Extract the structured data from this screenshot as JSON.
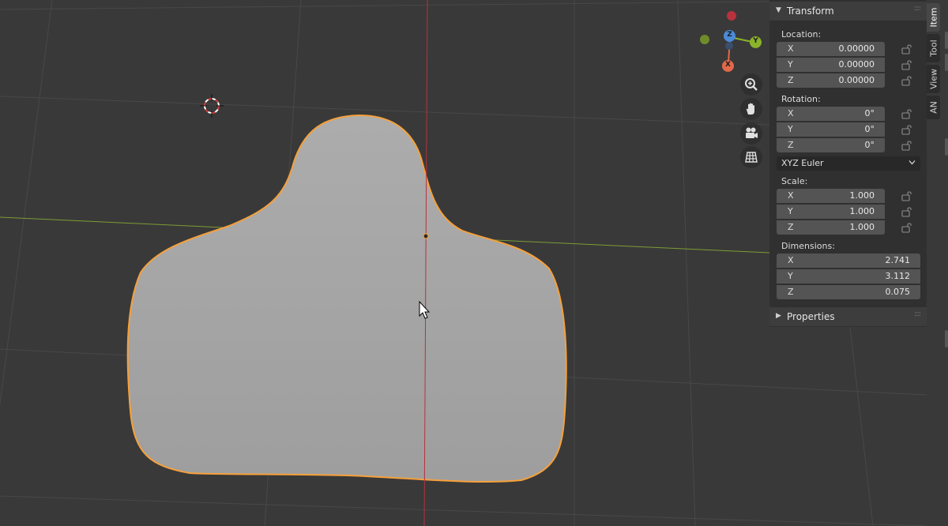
{
  "transform_panel": {
    "title": "Transform",
    "location": {
      "label": "Location:",
      "rows": [
        {
          "axis": "X",
          "value": "0.00000"
        },
        {
          "axis": "Y",
          "value": "0.00000"
        },
        {
          "axis": "Z",
          "value": "0.00000"
        }
      ]
    },
    "rotation": {
      "label": "Rotation:",
      "rows": [
        {
          "axis": "X",
          "value": "0°"
        },
        {
          "axis": "Y",
          "value": "0°"
        },
        {
          "axis": "Z",
          "value": "0°"
        }
      ],
      "mode": "XYZ Euler"
    },
    "scale": {
      "label": "Scale:",
      "rows": [
        {
          "axis": "X",
          "value": "1.000"
        },
        {
          "axis": "Y",
          "value": "1.000"
        },
        {
          "axis": "Z",
          "value": "1.000"
        }
      ]
    },
    "dimensions": {
      "label": "Dimensions:",
      "rows": [
        {
          "axis": "X",
          "value": "2.741"
        },
        {
          "axis": "Y",
          "value": "3.112"
        },
        {
          "axis": "Z",
          "value": "0.075"
        }
      ]
    }
  },
  "properties_panel": {
    "title": "Properties"
  },
  "side_tabs": [
    {
      "label": "Item",
      "active": true
    },
    {
      "label": "Tool",
      "active": false
    },
    {
      "label": "View",
      "active": false
    },
    {
      "label": "AN",
      "active": false
    }
  ],
  "gizmo": {
    "labels": {
      "x": "X",
      "y": "Y",
      "z": "Z"
    },
    "colors": {
      "x": "#e2694a",
      "y": "#8bb22b",
      "z": "#4b8ad9",
      "neg_x": "#b8323e",
      "neg_y": "#6f8c2a"
    }
  },
  "navigation": {
    "icons": [
      "zoom-icon",
      "pan-hand-icon",
      "camera-icon",
      "grid-icon"
    ]
  },
  "viewport": {
    "selection_color": "#f6a03b",
    "mesh_color": "#a6a6a6",
    "x_axis_color": "#b8323e",
    "y_axis_color": "#7c9d34"
  }
}
